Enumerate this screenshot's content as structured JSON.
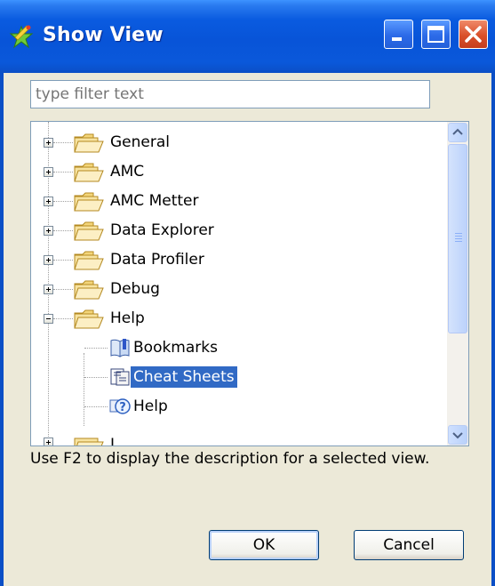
{
  "window": {
    "title": "Show View",
    "icon": "view-star-icon",
    "controls": [
      "minimize-icon",
      "maximize-icon",
      "close-icon"
    ]
  },
  "filter": {
    "value": "",
    "placeholder": "type filter text"
  },
  "tree": {
    "items": [
      {
        "label": "General",
        "type": "folder",
        "expanded": false
      },
      {
        "label": "AMC",
        "type": "folder",
        "expanded": false
      },
      {
        "label": "AMC Metter",
        "type": "folder",
        "expanded": false
      },
      {
        "label": "Data Explorer",
        "type": "folder",
        "expanded": false
      },
      {
        "label": "Data Profiler",
        "type": "folder",
        "expanded": false
      },
      {
        "label": "Debug",
        "type": "folder",
        "expanded": false
      },
      {
        "label": "Help",
        "type": "folder",
        "expanded": true,
        "children": [
          {
            "label": "Bookmarks",
            "icon": "bookmarks-icon",
            "selected": false
          },
          {
            "label": "Cheat Sheets",
            "icon": "cheat-sheets-icon",
            "selected": true
          },
          {
            "label": "Help",
            "icon": "help-icon",
            "selected": false
          }
        ]
      },
      {
        "label": "J",
        "type": "folder",
        "expanded": false,
        "partially_visible": true
      }
    ]
  },
  "hint": "Use F2 to display the description for a selected view.",
  "buttons": {
    "ok": "OK",
    "cancel": "Cancel"
  },
  "colors": {
    "titlebar": "#0A58DA",
    "selection": "#316AC5",
    "dialog_bg": "#ECE9D8"
  }
}
